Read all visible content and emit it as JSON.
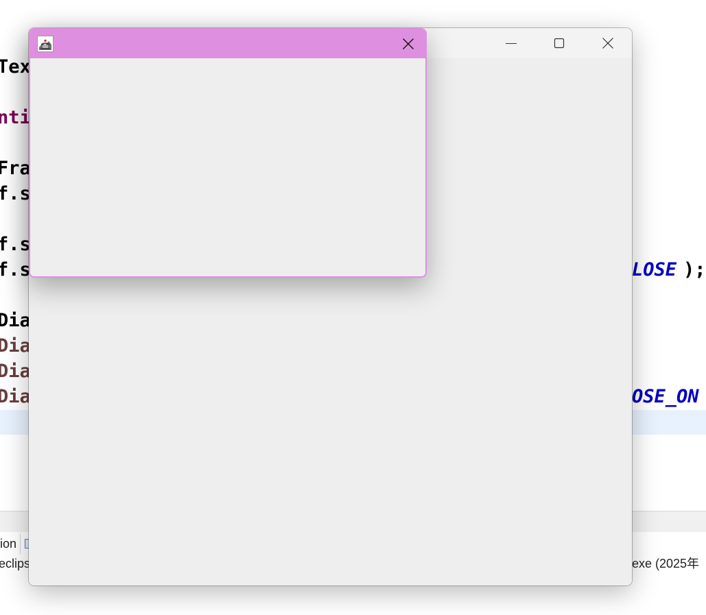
{
  "editor": {
    "lines": [
      {
        "text": "Tex",
        "style": "black"
      },
      {
        "text": "nti",
        "style": "purple"
      },
      {
        "text": "Fra",
        "style": "black"
      },
      {
        "text": "f.s",
        "style": "black"
      },
      {
        "text": "f.s",
        "style": "black"
      },
      {
        "text": "f.s",
        "style": "black"
      },
      {
        "text": "Dia",
        "style": "black"
      },
      {
        "text": "Dia",
        "style": "brown"
      },
      {
        "text": "Dia",
        "style": "brown"
      },
      {
        "text": "Dia",
        "style": "brown"
      }
    ],
    "right_fragments": {
      "close_const": "LOSE",
      "close_tail": ");",
      "dispose_const": "OSE_ON"
    },
    "colors": {
      "keyword": "#7f0055",
      "local_var": "#6a3e3e",
      "constant": "#0000c0",
      "current_line": "#e8f2fe"
    }
  },
  "bottom_panel": {
    "tab_label": "ion",
    "console_icon": "console-icon",
    "status_left": "eclips",
    "status_right": ".exe  (2025年"
  },
  "frame": {
    "title": "",
    "buttons": {
      "minimize": "minimize-icon",
      "maximize": "maximize-icon",
      "close": "close-icon"
    },
    "background": "#eeeeee"
  },
  "dialog": {
    "title": "",
    "icon": "java-coffee-icon",
    "close": "close-icon",
    "accent_color": "#df8fe0",
    "background": "#eeeeee"
  }
}
